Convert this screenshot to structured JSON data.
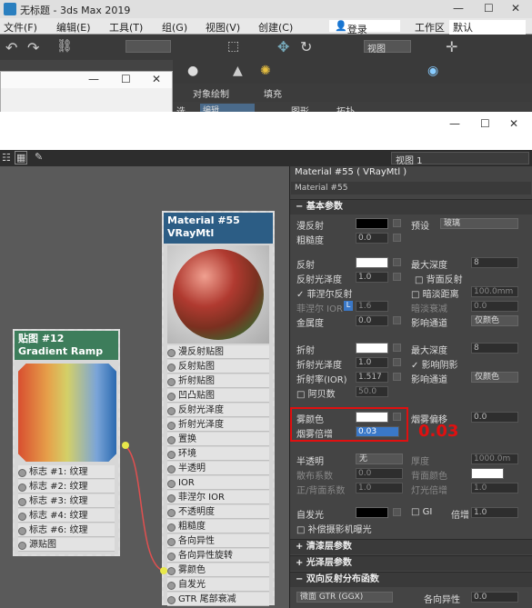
{
  "app": {
    "title": "无标题 - 3ds Max 2019",
    "login": "登录",
    "workspace_label": "工作区",
    "workspace_value": "默认",
    "view_drop": "视图"
  },
  "menu": [
    "文件(F)",
    "编辑(E)",
    "工具(T)",
    "组(G)",
    "视图(V)",
    "创建(C)"
  ],
  "ribbon": {
    "tab1": "对象绘制",
    "tab2": "填充"
  },
  "ribbon2": {
    "edit_label": "选",
    "field1": "编辑",
    "label2": "图形",
    "label3": "拓扑"
  },
  "editor": {
    "view_dropdown": "视图 1",
    "panel_title": "Material #55  ( VRayMtl )",
    "material_name": "Material #55"
  },
  "nodes": {
    "vray": {
      "title": "Material #55",
      "subtitle": "VRayMtl",
      "slots": [
        "漫反射贴图",
        "反射贴图",
        "折射贴图",
        "凹凸贴图",
        "反射光泽度",
        "折射光泽度",
        "置换",
        "环境",
        "半透明",
        "IOR",
        "菲涅尔 IOR",
        "不透明度",
        "粗糙度",
        "各向异性",
        "各向异性旋转",
        "雾颜色",
        "自发光",
        "GTR 尾部衰减"
      ]
    },
    "gradient": {
      "title": "贴图 #12",
      "subtitle": "Gradient Ramp",
      "slots": [
        "标志 #1: 纹理",
        "标志 #2: 纹理",
        "标志 #3: 纹理",
        "标志 #4: 纹理",
        "标志 #6: 纹理",
        "源贴图"
      ]
    }
  },
  "params": {
    "section_basic": "基本参数",
    "diffuse": "漫反射",
    "preset": "预设",
    "preset_value": "玻璃",
    "roughness": "粗糙度",
    "roughness_val": "0.0",
    "reflect": "反射",
    "max_depth": "最大深度",
    "max_depth_val": "8",
    "refl_gloss": "反射光泽度",
    "refl_gloss_val": "1.0",
    "backside": "背面反射",
    "fresnel": "菲涅尔反射",
    "dim_dist": "暗淡距离",
    "dim_dist_val": "100.0mm",
    "fresnel_ior": "菲涅尔 IOR",
    "fresnel_ior_val": "1.6",
    "dim_falloff": "暗淡衰减",
    "dim_falloff_val": "0.0",
    "metalness": "金属度",
    "metalness_val": "0.0",
    "affect_ch": "影响通道",
    "color_only": "仅颜色",
    "refract": "折射",
    "max_depth2": "最大深度",
    "max_depth2_val": "8",
    "refr_gloss": "折射光泽度",
    "refr_gloss_val": "1.0",
    "affect_shadow": "影响阴影",
    "refr_ior": "折射率(IOR)",
    "refr_ior_val": "1.517",
    "affect_ch2": "影响通道",
    "color_only2": "仅颜色",
    "abbe": "阿贝数",
    "abbe_val": "50.0",
    "fog_color": "雾颜色",
    "fog_bias": "烟雾偏移",
    "fog_bias_val": "0.0",
    "fog_mult": "烟雾倍增",
    "fog_mult_val": "0.03",
    "annotation": "0.03",
    "translucency": "半透明",
    "transl_val": "无",
    "thickness": "厚度",
    "thickness_val": "1000.0m",
    "scatter": "散布系数",
    "scatter_val": "0.0",
    "back_color": "背面颜色",
    "fb": "正/背面系数",
    "fb_val": "1.0",
    "light_mult": "灯光倍增",
    "light_mult_val": "1.0",
    "selfillum": "自发光",
    "gi": "GI",
    "mult": "倍增",
    "mult_val": "1.0",
    "comp_cam": "补偿摄影机曝光",
    "section_coat": "清漆层参数",
    "section_sheen": "光泽层参数",
    "section_brdf": "双向反射分布函数",
    "brdf_type": "微面 GTR (GGX)",
    "anisotropy": "各向异性",
    "aniso_val": "0.0"
  },
  "colors": {
    "vray_head": "#2c5d85",
    "gradient_head": "#3d7d5b",
    "highlight": "#e01010"
  }
}
